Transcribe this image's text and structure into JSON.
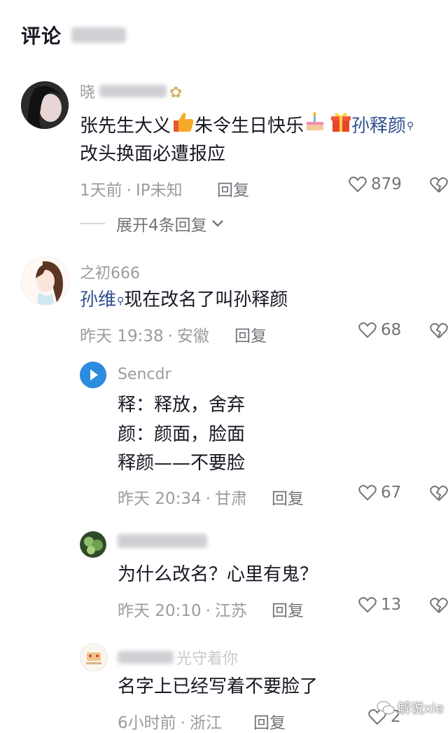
{
  "header": {
    "title": "评论"
  },
  "comments": [
    {
      "name": "晓",
      "text_line1_a": "张先生大义",
      "text_line1_b": "朱令生日快乐",
      "text_line1_mention": "孙释颜",
      "text_line2": "改头换面必遭报应",
      "time": "1天前",
      "location": "IP未知",
      "reply_label": "回复",
      "likes": "879",
      "expand_label": "展开4条回复"
    },
    {
      "name": "之初666",
      "mention": "孙维",
      "text": "现在改名了叫孙释颜",
      "time": "昨天 19:38",
      "location": "安徽",
      "reply_label": "回复",
      "likes": "68"
    },
    {
      "name": "Sencdr",
      "lines": [
        "释：释放，舍弃",
        "颜：颜面，脸面",
        "释颜——不要脸"
      ],
      "time": "昨天 20:34",
      "location": "甘肃",
      "reply_label": "回复",
      "likes": "67"
    },
    {
      "name": "",
      "text": "为什么改名？心里有鬼？",
      "time": "昨天 20:10",
      "location": "江苏",
      "reply_label": "回复",
      "likes": "13"
    },
    {
      "name_visible": "光守着你",
      "text": "名字上已经写着不要脸了",
      "time": "6小时前",
      "location": "浙江",
      "reply_label": "回复",
      "likes": "2"
    }
  ],
  "watermark": {
    "text": "解说xie"
  },
  "colors": {
    "text": "#161823",
    "meta": "#9b9ca1",
    "mention": "#2f4f8f",
    "background": "#ffffff"
  }
}
